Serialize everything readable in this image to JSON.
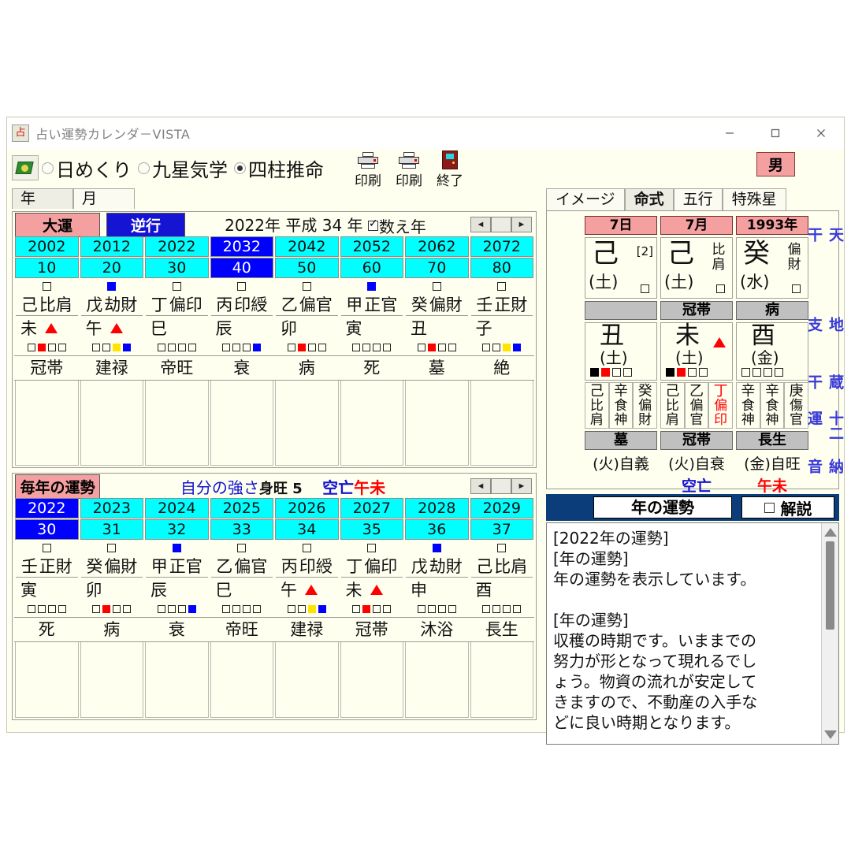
{
  "window": {
    "title": "占い運勢カレンダ－VISTA",
    "icon": "app-icon",
    "minimize": "–",
    "maximize": "□",
    "close": "✕"
  },
  "toolbar": {
    "book_icon": "book-icon",
    "modes": [
      {
        "label": "日めくり",
        "selected": false
      },
      {
        "label": "九星気学",
        "selected": false
      },
      {
        "label": "四柱推命",
        "selected": true
      }
    ],
    "actions": [
      {
        "label": "印刷",
        "icon": "printer-icon"
      },
      {
        "label": "印刷",
        "icon": "printer-icon"
      },
      {
        "label": "終了",
        "icon": "exit-door-icon"
      }
    ],
    "gender_badge": "男"
  },
  "left_tabs": [
    {
      "label": "年",
      "active": true
    },
    {
      "label": "月",
      "active": false
    }
  ],
  "right_tabs": [
    {
      "label": "イメージ",
      "active": false
    },
    {
      "label": "命式",
      "active": true
    },
    {
      "label": "五行",
      "active": false
    },
    {
      "label": "特殊星",
      "active": false
    }
  ],
  "daiun": {
    "tag": "大運",
    "direction": "逆行",
    "year_text": "2022年  平成 34 年",
    "counted_age_label": "数え年",
    "counted_age_checked": true,
    "spinner_left": "◄",
    "spinner_right": "►",
    "columns": [
      {
        "year": "2002",
        "age": "10",
        "selected": false,
        "top_mark": "hollow",
        "stem": "己",
        "ten_god": "比肩",
        "branch": "未",
        "triangle": true,
        "squares": [
          "hollow",
          "red",
          "hollow",
          "hollow"
        ],
        "stage": "冠帯"
      },
      {
        "year": "2012",
        "age": "20",
        "selected": false,
        "top_mark": "blue",
        "stem": "戊",
        "ten_god": "劫財",
        "branch": "午",
        "triangle": true,
        "squares": [
          "hollow",
          "hollow",
          "yellow",
          "blue"
        ],
        "stage": "建禄"
      },
      {
        "year": "2022",
        "age": "30",
        "selected": false,
        "top_mark": "hollow",
        "stem": "丁",
        "ten_god": "偏印",
        "branch": "巳",
        "triangle": false,
        "squares": [
          "hollow",
          "hollow",
          "hollow",
          "hollow"
        ],
        "stage": "帝旺"
      },
      {
        "year": "2032",
        "age": "40",
        "selected": true,
        "top_mark": "hollow",
        "stem": "丙",
        "ten_god": "印綬",
        "branch": "辰",
        "triangle": false,
        "squares": [
          "hollow",
          "hollow",
          "hollow",
          "blue"
        ],
        "stage": "衰"
      },
      {
        "year": "2042",
        "age": "50",
        "selected": false,
        "top_mark": "hollow",
        "stem": "乙",
        "ten_god": "偏官",
        "branch": "卯",
        "triangle": false,
        "squares": [
          "hollow",
          "red",
          "hollow",
          "hollow"
        ],
        "stage": "病"
      },
      {
        "year": "2052",
        "age": "60",
        "selected": false,
        "top_mark": "blue",
        "stem": "甲",
        "ten_god": "正官",
        "branch": "寅",
        "triangle": false,
        "squares": [
          "hollow",
          "hollow",
          "hollow",
          "hollow"
        ],
        "stage": "死"
      },
      {
        "year": "2062",
        "age": "70",
        "selected": false,
        "top_mark": "hollow",
        "stem": "癸",
        "ten_god": "偏財",
        "branch": "丑",
        "triangle": false,
        "squares": [
          "hollow",
          "red",
          "hollow",
          "hollow"
        ],
        "stage": "墓"
      },
      {
        "year": "2072",
        "age": "80",
        "selected": false,
        "top_mark": "hollow",
        "stem": "壬",
        "ten_god": "正財",
        "branch": "子",
        "triangle": false,
        "squares": [
          "hollow",
          "hollow",
          "yellow",
          "blue"
        ],
        "stage": "絶"
      }
    ]
  },
  "yearly": {
    "tag": "毎年の運勢",
    "strength_label": "自分の強さ",
    "strength_value": "身旺 5",
    "kubou_label": "空亡",
    "kubou_value": "午未",
    "spinner_left": "◄",
    "spinner_right": "►",
    "columns": [
      {
        "year": "2022",
        "age": "30",
        "selected": true,
        "top_mark": "hollow",
        "stem": "壬",
        "ten_god": "正財",
        "branch": "寅",
        "triangle": false,
        "squares": [
          "hollow",
          "hollow",
          "hollow",
          "hollow"
        ],
        "stage": "死"
      },
      {
        "year": "2023",
        "age": "31",
        "selected": false,
        "top_mark": "hollow",
        "stem": "癸",
        "ten_god": "偏財",
        "branch": "卯",
        "triangle": false,
        "squares": [
          "hollow",
          "red",
          "hollow",
          "hollow"
        ],
        "stage": "病"
      },
      {
        "year": "2024",
        "age": "32",
        "selected": false,
        "top_mark": "blue",
        "stem": "甲",
        "ten_god": "正官",
        "branch": "辰",
        "triangle": false,
        "squares": [
          "hollow",
          "hollow",
          "hollow",
          "blue"
        ],
        "stage": "衰"
      },
      {
        "year": "2025",
        "age": "33",
        "selected": false,
        "top_mark": "hollow",
        "stem": "乙",
        "ten_god": "偏官",
        "branch": "巳",
        "triangle": false,
        "squares": [
          "hollow",
          "hollow",
          "hollow",
          "hollow"
        ],
        "stage": "帝旺"
      },
      {
        "year": "2026",
        "age": "34",
        "selected": false,
        "top_mark": "hollow",
        "stem": "丙",
        "ten_god": "印綬",
        "branch": "午",
        "triangle": true,
        "squares": [
          "hollow",
          "hollow",
          "yellow",
          "blue"
        ],
        "stage": "建禄"
      },
      {
        "year": "2027",
        "age": "35",
        "selected": false,
        "top_mark": "hollow",
        "stem": "丁",
        "ten_god": "偏印",
        "branch": "未",
        "triangle": true,
        "squares": [
          "hollow",
          "red",
          "hollow",
          "hollow"
        ],
        "stage": "冠帯"
      },
      {
        "year": "2028",
        "age": "36",
        "selected": false,
        "top_mark": "blue",
        "stem": "戊",
        "ten_god": "劫財",
        "branch": "申",
        "triangle": false,
        "squares": [
          "hollow",
          "hollow",
          "hollow",
          "hollow"
        ],
        "stage": "沐浴"
      },
      {
        "year": "2029",
        "age": "37",
        "selected": false,
        "top_mark": "hollow",
        "stem": "己",
        "ten_god": "比肩",
        "branch": "酉",
        "triangle": false,
        "squares": [
          "hollow",
          "hollow",
          "hollow",
          "hollow"
        ],
        "stage": "長生"
      }
    ]
  },
  "meishiki": {
    "vertical_labels": [
      "天干",
      "地支",
      "蔵干",
      "十二運",
      "納音"
    ],
    "pillars": [
      {
        "header": "7日",
        "stem": "己",
        "stem_element": "(土)",
        "stem_ten_god": "",
        "stem_index": "[2]",
        "stem_square": "hollow",
        "stage_top": "",
        "branch": "丑",
        "branch_element": "(土)",
        "branch_triangle": false,
        "branch_squares": [
          "black",
          "red",
          "hollow",
          "hollow"
        ],
        "hidden": [
          {
            "stem": "己",
            "god": "比肩",
            "red": false
          },
          {
            "stem": "辛",
            "god": "食神",
            "red": false
          },
          {
            "stem": "癸",
            "god": "偏財",
            "red": false
          }
        ],
        "stage": "墓",
        "nayin": "(火)自義"
      },
      {
        "header": "7月",
        "stem": "己",
        "stem_element": "(土)",
        "stem_ten_god": "比肩",
        "stem_index": "",
        "stem_square": "hollow",
        "stage_top": "冠帯",
        "branch": "未",
        "branch_element": "(土)",
        "branch_triangle": true,
        "branch_squares": [
          "black",
          "red",
          "hollow",
          "hollow"
        ],
        "hidden": [
          {
            "stem": "己",
            "god": "比肩",
            "red": false
          },
          {
            "stem": "乙",
            "god": "偏官",
            "red": false
          },
          {
            "stem": "丁",
            "god": "偏印",
            "red": true
          }
        ],
        "stage": "冠帯",
        "nayin": "(火)自衰"
      },
      {
        "header": "1993年",
        "stem": "癸",
        "stem_element": "(水)",
        "stem_ten_god": "偏財",
        "stem_index": "",
        "stem_square": "hollow",
        "stage_top": "病",
        "branch": "酉",
        "branch_element": "(金)",
        "branch_triangle": false,
        "branch_squares": [
          "hollow",
          "hollow",
          "hollow",
          "hollow"
        ],
        "hidden": [
          {
            "stem": "辛",
            "god": "食神",
            "red": false
          },
          {
            "stem": "辛",
            "god": "食神",
            "red": false
          },
          {
            "stem": "庚",
            "god": "傷官",
            "red": false
          }
        ],
        "stage": "長生",
        "nayin": "(金)自旺"
      }
    ],
    "kubou_label": "空亡",
    "kubou_value": "午未"
  },
  "fortune_panel": {
    "title": "年の運勢",
    "explain_label": "解説",
    "explain_checked": false,
    "body": "[2022年の運勢]\n[年の運勢]\n年の運勢を表示しています。\n\n[年の運勢]\n収穫の時期です。いままでの\n努力が形となって現れるでし\nょう。物資の流れが安定して\nきますので、不動産の入手な\nどに良い時期となります。\n\n[恋愛運]"
  }
}
